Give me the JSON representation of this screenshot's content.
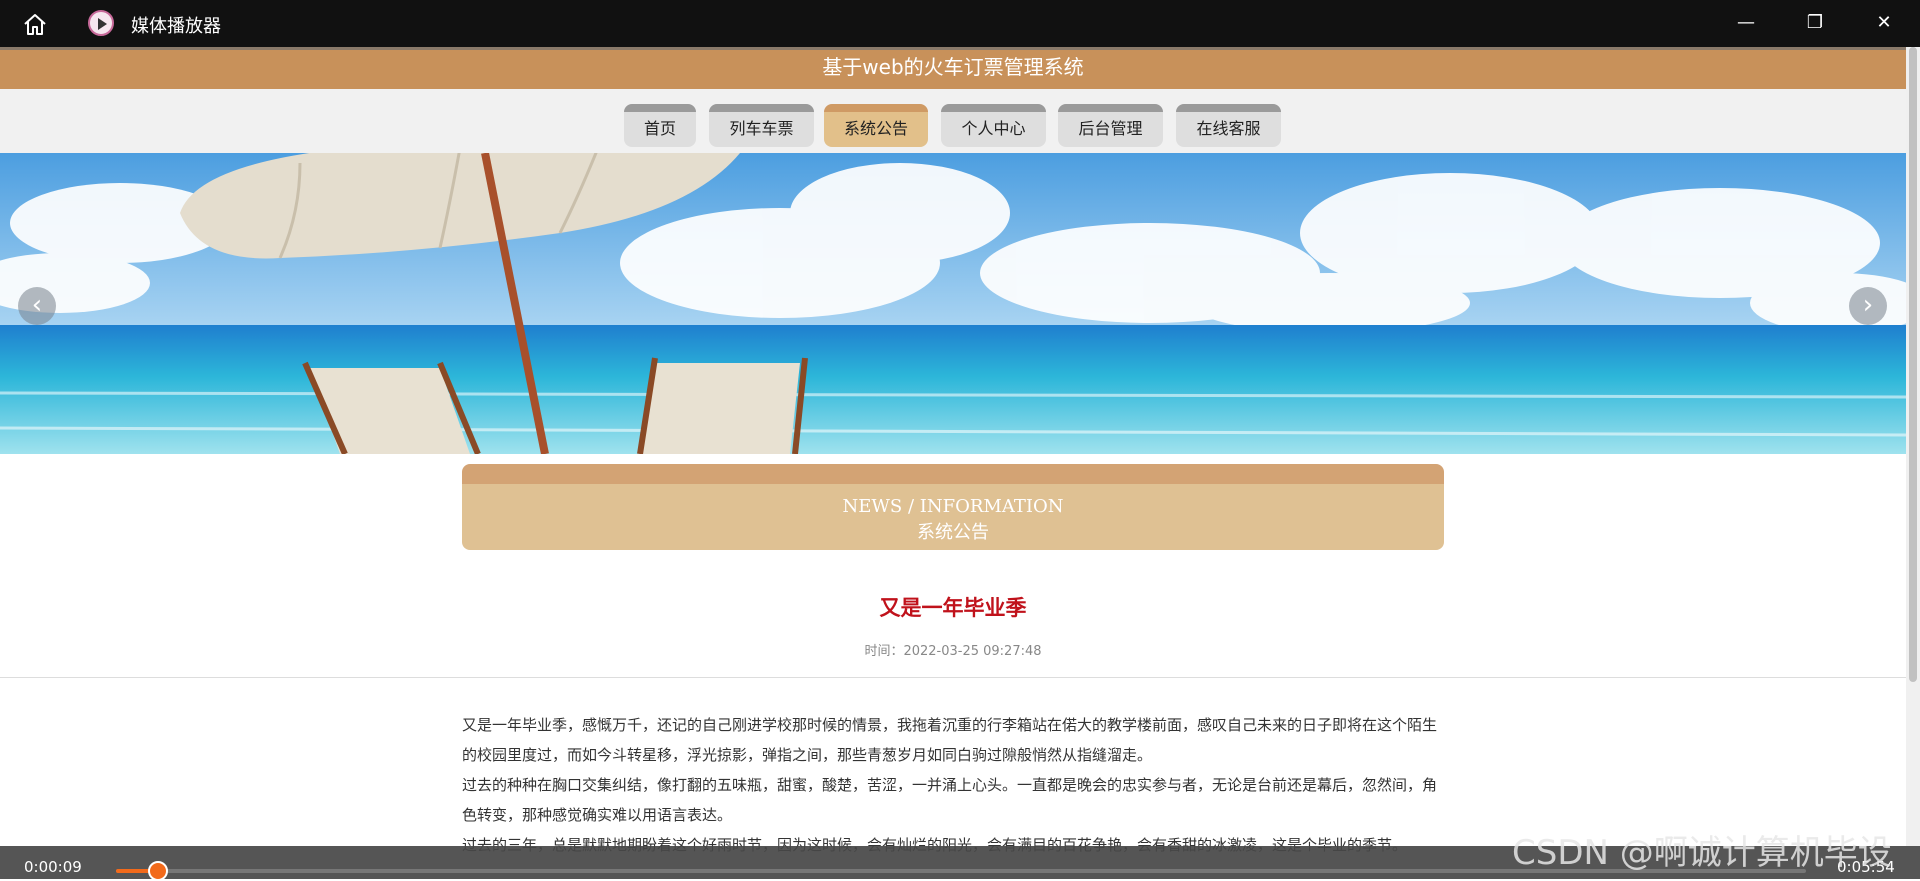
{
  "window": {
    "title": "媒体播放器",
    "minimize_glyph": "—",
    "restore_glyph": "❐",
    "close_glyph": "✕"
  },
  "site": {
    "title": "基于web的火车订票管理系统",
    "nav": [
      {
        "label": "首页",
        "active": false
      },
      {
        "label": "列车车票",
        "active": false
      },
      {
        "label": "系统公告",
        "active": true
      },
      {
        "label": "个人中心",
        "active": false
      },
      {
        "label": "后台管理",
        "active": false
      },
      {
        "label": "在线客服",
        "active": false
      }
    ],
    "banner": {
      "prev_glyph": "‹",
      "next_glyph": "›"
    }
  },
  "news": {
    "heading_en": "NEWS / INFORMATION",
    "heading_cn": "系统公告"
  },
  "article": {
    "title": "又是一年毕业季",
    "time": "时间：2022-03-25 09:27:48",
    "paragraphs": [
      "又是一年毕业季，感慨万千，还记的自己刚进学校那时候的情景，我拖着沉重的行李箱站在偌大的教学楼前面，感叹自己未来的日子即将在这个陌生的校园里度过，而如今斗转星移，浮光掠影，弹指之间，那些青葱岁月如同白驹过隙般悄然从指缝溜走。",
      "过去的种种在胸口交集纠结，像打翻的五味瓶，甜蜜，酸楚，苦涩，一并涌上心头。一直都是晚会的忠实参与者，无论是台前还是幕后，忽然间，角色转变，那种感觉确实难以用语言表达。",
      "过去的三年，总是默默地期盼着这个好雨时节，因为这时候，会有灿烂的阳光，会有满目的百花争艳，会有香甜的冰激凌，这是个毕业的季节。"
    ]
  },
  "player": {
    "current_time": "0:00:09",
    "total_time": "0:05:54",
    "progress": 0.025
  },
  "watermark": "CSDN @啊诚计算机毕设",
  "colors": {
    "brand": "#c8915a",
    "nav_active": "#e2c08a",
    "article_title": "#c0121b",
    "progress": "#f26a1b"
  },
  "icons": {
    "home": "home-icon",
    "app": "media-player-icon"
  }
}
